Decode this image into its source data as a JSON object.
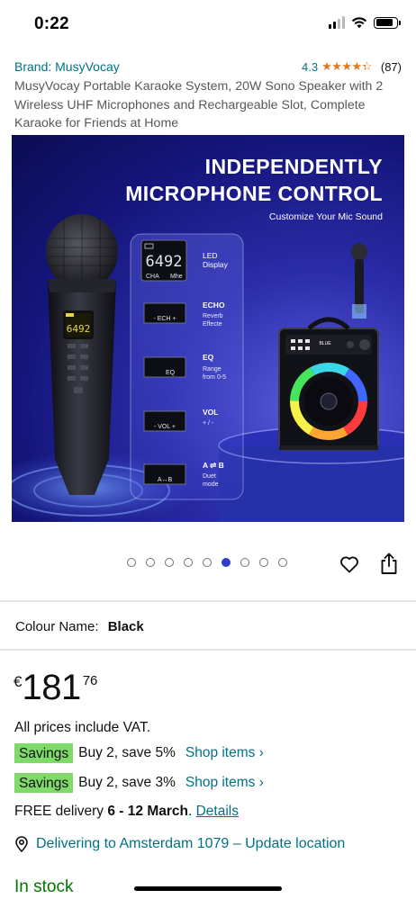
{
  "status_bar": {
    "time": "0:22"
  },
  "product": {
    "brand": "Brand: MusyVocay",
    "rating_value": "4.3",
    "rating_stars": 4.3,
    "rating_count": "(87)",
    "title": "MusyVocay Portable Karaoke System, 20W Sono Speaker with 2 Wireless UHF Microphones and Rechargeable Slot, Complete Karaoke for Friends at Home"
  },
  "hero": {
    "title_line1": "INDEPENDENTLY",
    "title_line2": "MICROPHONE CONTROL",
    "subtitle": "Customize Your Mic Sound",
    "lcd_digits": "6492",
    "lcd_left": "CHA",
    "lcd_right": "Mhe",
    "mic_lcd": "6492",
    "mic_labels": [
      "- VOL +",
      "- ECH -",
      "EQ",
      "A↔B"
    ],
    "features": [
      {
        "key": "- ECH +",
        "title": "ECHO",
        "desc1": "Reverb",
        "desc2": "Effecte"
      },
      {
        "key": "EQ",
        "title": "EQ",
        "desc1": "Range",
        "desc2": "from 0-5"
      },
      {
        "key": "- VOL +",
        "title": "VOL",
        "desc1": "+ / -",
        "desc2": ""
      },
      {
        "key": "A↔B",
        "title": "A ⇌ B",
        "desc1": "Duet",
        "desc2": "mode"
      }
    ],
    "led_title1": "LED",
    "led_title2": "Display",
    "speaker_brand": "BLUE"
  },
  "carousel": {
    "count": 9,
    "active_index": 5
  },
  "colour": {
    "label": "Colour Name:",
    "value": "Black"
  },
  "price": {
    "currency": "€",
    "whole": "181",
    "fraction": "76"
  },
  "vat_note": "All prices include VAT.",
  "savings": [
    {
      "badge": "Savings",
      "text": "Buy 2, save 5%",
      "link": "Shop items ›"
    },
    {
      "badge": "Savings",
      "text": "Buy 2, save 3%",
      "link": "Shop items ›"
    }
  ],
  "delivery": {
    "prefix": "FREE delivery ",
    "dates": "6 - 12 March",
    "suffix": ". ",
    "details_link": "Details"
  },
  "location": {
    "text": "Delivering to Amsterdam 1079 – Update location"
  },
  "stock": "In stock",
  "colors": {
    "link": "#007185",
    "star": "#de7921",
    "badge": "#7fda69",
    "stock": "#007600",
    "dot_active": "#2d3ec9"
  }
}
